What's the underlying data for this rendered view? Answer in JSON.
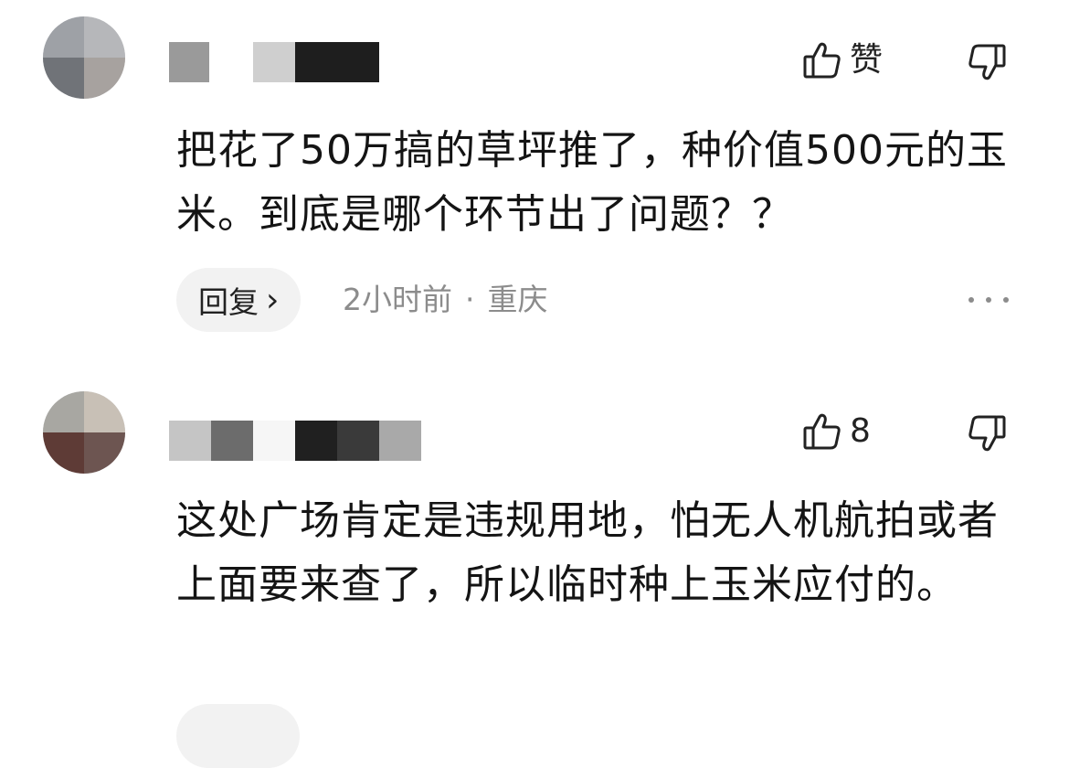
{
  "comments": [
    {
      "like_label": "赞",
      "text": "把花了50万搞的草坪推了，种价值500元的玉米。到底是哪个环节出了问题？？",
      "reply_label": "回复",
      "reply_chevron": "›",
      "time": "2小时前",
      "separator": "·",
      "location": "重庆"
    },
    {
      "like_label": "8",
      "text": "这处广场肯定是违规用地，怕无人机航拍或者上面要来查了，所以临时种上玉米应付的。"
    }
  ],
  "icons": {
    "like": "thumbs-up-icon",
    "dislike": "thumbs-down-icon",
    "more": "more-dots-icon",
    "reply_arrow": "chevron-right-icon"
  },
  "colors": {
    "reply_pill_bg": "#f2f2f2",
    "meta_text": "#8c8c8c",
    "body_text": "#141414"
  }
}
